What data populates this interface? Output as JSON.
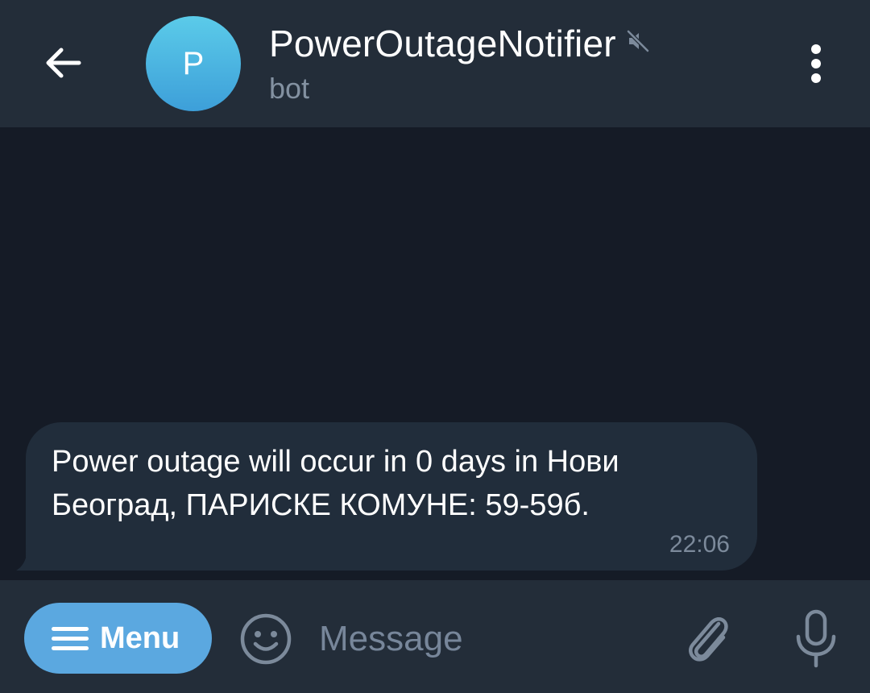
{
  "header": {
    "back_icon": "arrow-left-icon",
    "avatar_letter": "P",
    "title": "PowerOutageNotifier",
    "mute_icon": "muted-speaker-icon",
    "subtitle": "bot",
    "more_icon": "vertical-dots-icon"
  },
  "messages": [
    {
      "text": "Power outage will occur in 0 days in Нови Београд, ПАРИСКЕ КОМУНЕ: 59-59б.",
      "time": "22:06"
    }
  ],
  "composer": {
    "menu_icon": "hamburger-icon",
    "menu_label": "Menu",
    "emoji_icon": "smiley-icon",
    "placeholder": "Message",
    "attach_icon": "paperclip-icon",
    "mic_icon": "microphone-icon"
  },
  "colors": {
    "chat_background": "#151b26",
    "bar_background": "#232d39",
    "bubble_background": "#212d3b",
    "accent": "#5ba8e0",
    "avatar_gradient_top": "#5bcbe9",
    "avatar_gradient_bottom": "#3d9fd9",
    "secondary_text": "#8391a1"
  }
}
